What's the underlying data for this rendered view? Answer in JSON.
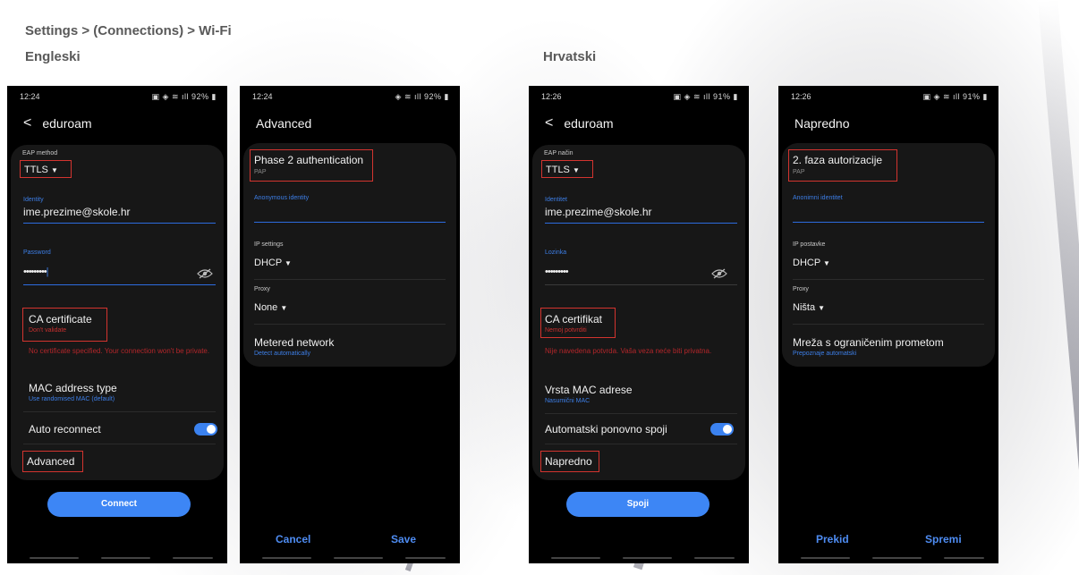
{
  "breadcrumb": "Settings > (Connections) > Wi-Fi",
  "sections": {
    "english": "Engleski",
    "croatian": "Hrvatski"
  },
  "phones": [
    {
      "time": "12:24",
      "status": "92%",
      "title": "eduroam",
      "eap_label": "EAP method",
      "eap_value": "TTLS",
      "identity_label": "Identity",
      "identity_value": "ime.prezime@skole.hr",
      "password_label": "Password",
      "password_value": "•••••••••",
      "ca_label": "CA certificate",
      "ca_value": "Don't validate",
      "ca_warning": "No certificate specified. Your connection won't be private.",
      "mac_label": "MAC address type",
      "mac_value": "Use randomised MAC (default)",
      "auto_label": "Auto reconnect",
      "advanced_label": "Advanced",
      "connect_label": "Connect"
    },
    {
      "time": "12:24",
      "status": "92%",
      "title": "Advanced",
      "phase2_label": "Phase 2 authentication",
      "phase2_value": "PAP",
      "anon_label": "Anonymous identity",
      "ip_label": "IP settings",
      "ip_value": "DHCP",
      "proxy_label": "Proxy",
      "proxy_value": "None",
      "metered_label": "Metered network",
      "metered_value": "Detect automatically",
      "cancel_label": "Cancel",
      "save_label": "Save"
    },
    {
      "time": "12:26",
      "status": "91%",
      "title": "eduroam",
      "eap_label": "EAP način",
      "eap_value": "TTLS",
      "identity_label": "Identitet",
      "identity_value": "ime.prezime@skole.hr",
      "password_label": "Lozinka",
      "password_value": "•••••••••",
      "ca_label": "CA certifikat",
      "ca_value": "Nemoj potvrditi",
      "ca_warning": "Nije navedena potvrda. Vaša veza neće biti privatna.",
      "mac_label": "Vrsta MAC adrese",
      "mac_value": "Nasumični MAC",
      "auto_label": "Automatski ponovno spoji",
      "advanced_label": "Napredno",
      "connect_label": "Spoji"
    },
    {
      "time": "12:26",
      "status": "91%",
      "title": "Napredno",
      "phase2_label": "2. faza autorizacije",
      "phase2_value": "PAP",
      "anon_label": "Anonimni identitet",
      "ip_label": "IP postavke",
      "ip_value": "DHCP",
      "proxy_label": "Proxy",
      "proxy_value": "Ništa",
      "metered_label": "Mreža s ograničenim prometom",
      "metered_value": "Prepoznaje automatski",
      "cancel_label": "Prekid",
      "save_label": "Spremi"
    }
  ],
  "colors": {
    "accent": "#3d86f5",
    "highlight": "#d3342f",
    "warning": "#b3262a"
  },
  "icons": [
    "back-arrow-icon",
    "dropdown-arrow-icon",
    "eye-hidden-icon",
    "toggle-switch-icon",
    "gallery-icon",
    "signal-icon",
    "battery-icon"
  ]
}
